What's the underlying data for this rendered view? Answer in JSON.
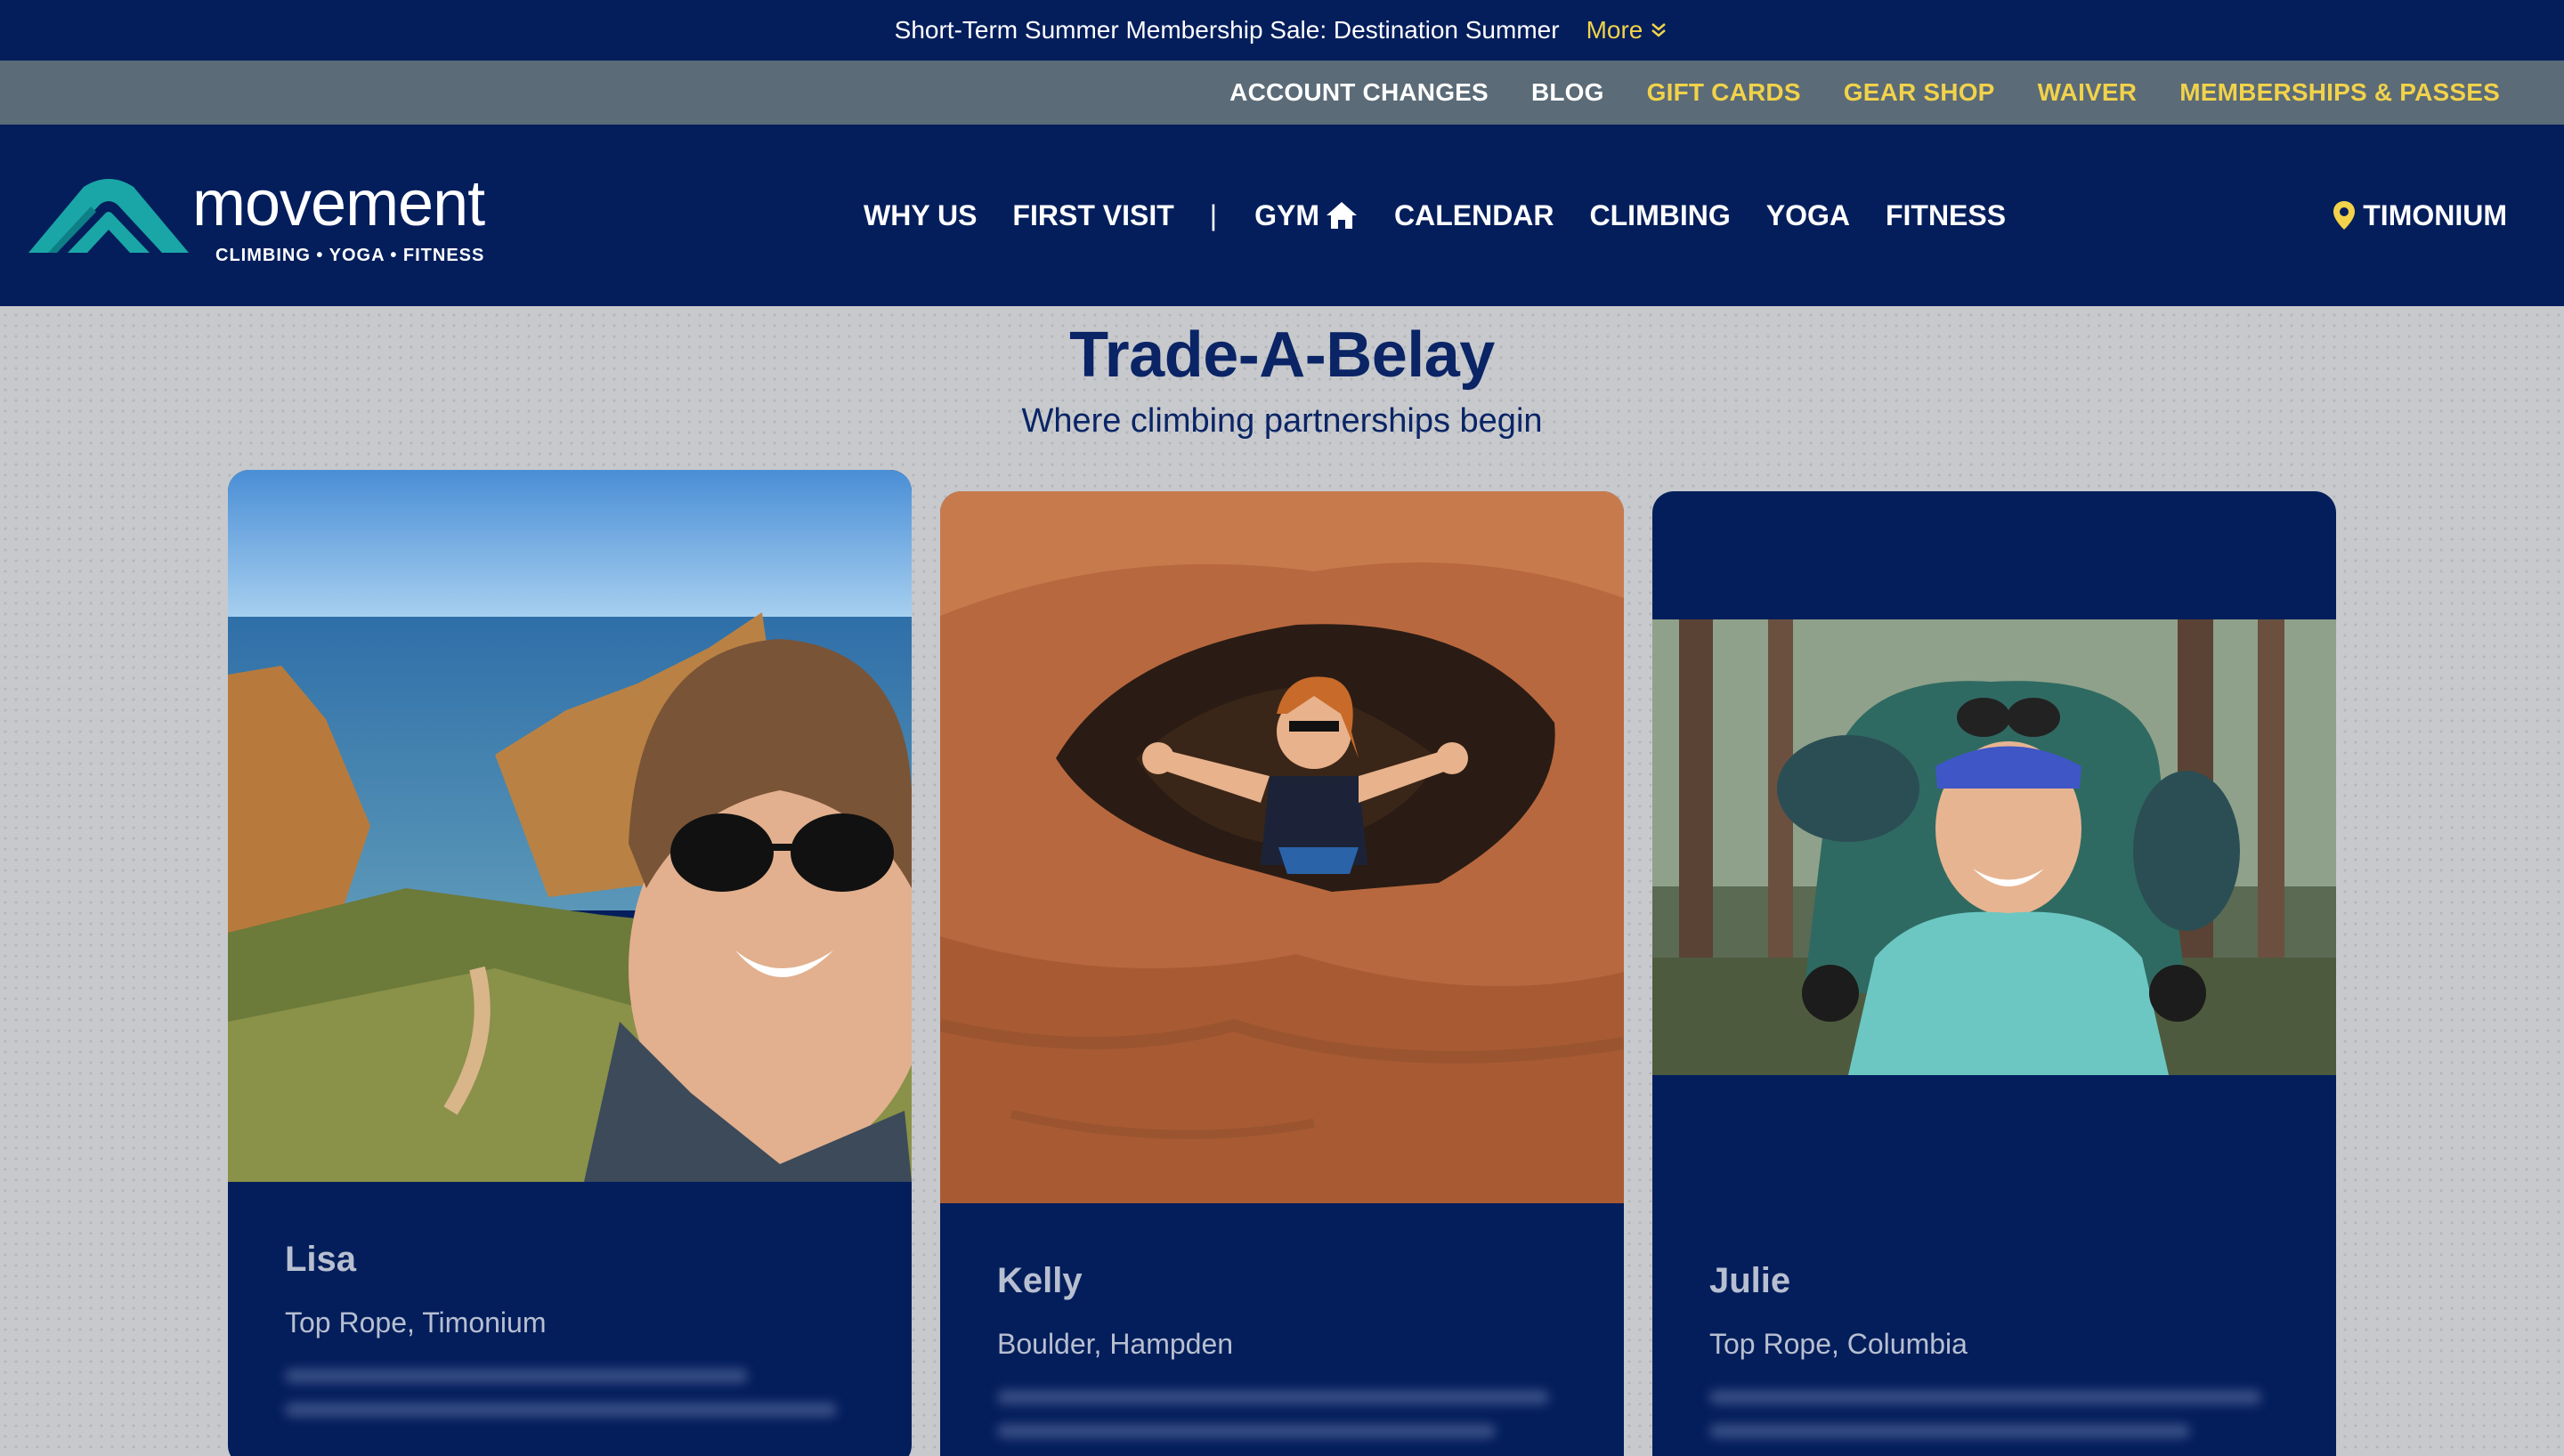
{
  "promo": {
    "text": "Short-Term Summer Membership Sale: Destination Summer",
    "more_label": "More",
    "icon": "double-chevron-down-icon"
  },
  "utility_nav": {
    "items": [
      {
        "label": "ACCOUNT CHANGES"
      },
      {
        "label": "BLOG"
      },
      {
        "label": "GIFT CARDS"
      },
      {
        "label": "GEAR SHOP"
      },
      {
        "label": "WAIVER"
      },
      {
        "label": "MEMBERSHIPS & PASSES"
      }
    ]
  },
  "logo": {
    "wordmark": "movement",
    "tagline": "CLIMBING • YOGA • FITNESS"
  },
  "main_nav": {
    "items": [
      {
        "label": "WHY US"
      },
      {
        "label": "FIRST VISIT"
      },
      {
        "label": "|"
      },
      {
        "label": "GYM",
        "icon": "home-icon"
      },
      {
        "label": "CALENDAR"
      },
      {
        "label": "CLIMBING"
      },
      {
        "label": "YOGA"
      },
      {
        "label": "FITNESS"
      }
    ],
    "location": {
      "label": "TIMONIUM",
      "icon": "map-pin-icon"
    }
  },
  "hero": {
    "title": "Trade-A-Belay",
    "subtitle": "Where climbing partnerships begin"
  },
  "cards": [
    {
      "name": "Lisa",
      "meta": "Top Rope, Timonium"
    },
    {
      "name": "Kelly",
      "meta": "Boulder, Hampden"
    },
    {
      "name": "Julie",
      "meta": "Top Rope, Columbia"
    }
  ],
  "colors": {
    "navy": "#041e5c",
    "accent_yellow": "#f1d24a",
    "utility_gray": "#5b6b78",
    "brand_teal": "#1aa6a6"
  }
}
